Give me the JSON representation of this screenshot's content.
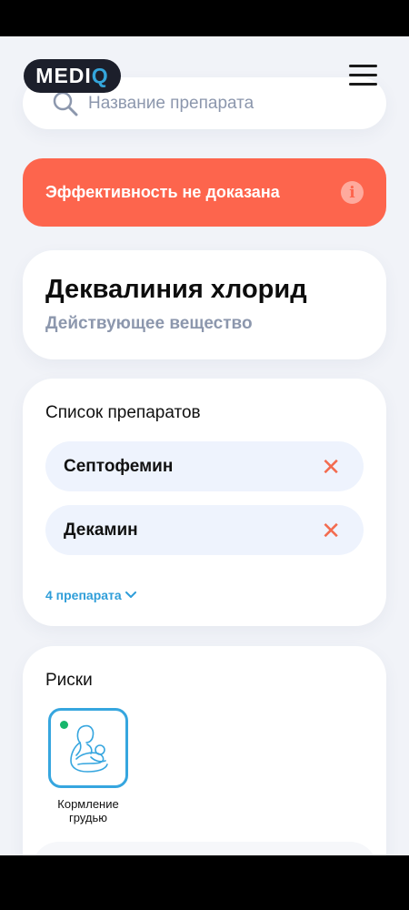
{
  "app": {
    "logo_text": "MEDI",
    "logo_q": "Q"
  },
  "search": {
    "placeholder": "Название препарата"
  },
  "warning": {
    "text": "Эффективность не доказана",
    "info_icon": "i"
  },
  "substance": {
    "name": "Деквалиния хлорид",
    "subtitle": "Действующее вещество"
  },
  "drugs": {
    "title": "Список препаратов",
    "items": [
      {
        "name": "Септофемин"
      },
      {
        "name": "Декамин"
      }
    ],
    "more_label": "4 препарата"
  },
  "risks": {
    "title": "Риски",
    "items": [
      {
        "label": "Кормление грудью",
        "icon": "breastfeeding-icon",
        "status_color": "#17b66b"
      }
    ]
  },
  "colors": {
    "accent": "#34a6dc",
    "warning": "#fd654d",
    "remove": "#f36b4f"
  }
}
